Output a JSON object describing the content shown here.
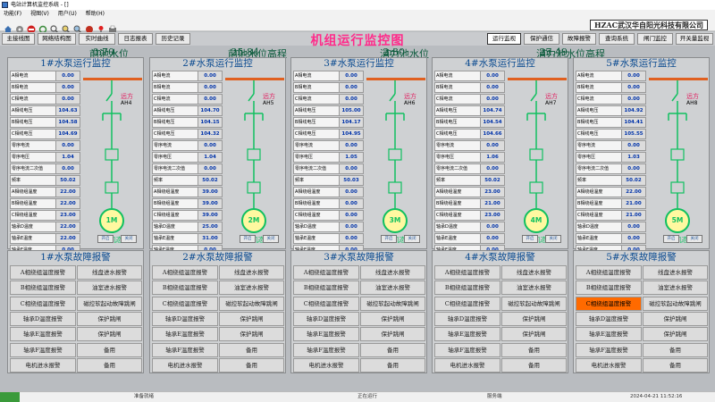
{
  "window": {
    "title": "电站计算机监控系统 - []"
  },
  "menu": [
    "功能(F)",
    "视图(V)",
    "用户(U)",
    "帮助(H)"
  ],
  "toolbar": {
    "icons": [
      "home-icon",
      "gear-icon",
      "stop-icon",
      "refresh-icon",
      "search-icon",
      "zoom-in-icon",
      "zoom-out-icon",
      "record-icon",
      "pin-icon",
      "print-icon"
    ]
  },
  "company": "HZAC武汉华自阳光科技有限公司",
  "nav_left": [
    "主接线图",
    "网络结构图",
    "实时曲线",
    "日志报表",
    "历史记录"
  ],
  "nav_right": [
    "运行监视",
    "保护通信",
    "故障报警",
    "查询系统",
    "闸门监控",
    "开关量监视"
  ],
  "page_title": "机组运行监控图",
  "levels": [
    {
      "label": "前池水位",
      "value": "0.70",
      "unit": "m"
    },
    {
      "label": "前池水位高程",
      "value": "25.84",
      "unit": "m"
    },
    {
      "label": "消力池水位",
      "value": "2.30",
      "unit": "m"
    },
    {
      "label": "消力池水位高程",
      "value": "27.49",
      "unit": "m"
    }
  ],
  "row_labels": [
    "A相电流",
    "B相电流",
    "C相电流",
    "A相线电压",
    "B相线电压",
    "C相线电压",
    "零序电流",
    "零序电压",
    "零序电流二次值",
    "频率",
    "A相绕组温度",
    "B相绕组温度",
    "C相绕组温度",
    "轴承D温度",
    "轴承E温度",
    "轴承F温度"
  ],
  "pumps": [
    {
      "title": "1#水泵运行监控",
      "values": [
        "0.00",
        "0.00",
        "0.00",
        "104.63",
        "104.58",
        "104.69",
        "0.00",
        "1.04",
        "0.00",
        "50.02",
        "22.00",
        "22.00",
        "23.00",
        "22.00",
        "22.00",
        "0.00"
      ],
      "ah": "AH4",
      "state": "停机态",
      "motor": "1M",
      "remote": "远方",
      "start": "开启",
      "stop": "关闭"
    },
    {
      "title": "2#水泵运行监控",
      "values": [
        "0.00",
        "0.00",
        "0.00",
        "104.70",
        "104.15",
        "104.32",
        "0.00",
        "1.04",
        "0.00",
        "50.02",
        "39.00",
        "39.00",
        "39.00",
        "25.00",
        "31.00",
        "0.00"
      ],
      "ah": "AH5",
      "state": "停机态",
      "motor": "2M",
      "remote": "远方",
      "start": "开启",
      "stop": "关闭"
    },
    {
      "title": "3#水泵运行监控",
      "values": [
        "0.00",
        "0.00",
        "0.00",
        "105.00",
        "104.17",
        "104.95",
        "0.00",
        "1.05",
        "0.00",
        "50.03",
        "0.00",
        "0.00",
        "0.00",
        "0.00",
        "0.00",
        "0.00"
      ],
      "ah": "AH6",
      "state": "停机态",
      "motor": "3M",
      "remote": "远方",
      "start": "开启",
      "stop": "关闭"
    },
    {
      "title": "4#水泵运行监控",
      "values": [
        "0.00",
        "0.00",
        "0.00",
        "104.74",
        "104.54",
        "104.66",
        "0.00",
        "1.06",
        "0.00",
        "50.02",
        "23.00",
        "21.00",
        "23.00",
        "0.00",
        "0.00",
        "0.00"
      ],
      "ah": "AH7",
      "state": "停机态",
      "motor": "4M",
      "remote": "远方",
      "start": "开启",
      "stop": "关闭"
    },
    {
      "title": "5#水泵运行监控",
      "values": [
        "0.00",
        "0.00",
        "0.00",
        "104.92",
        "104.41",
        "105.55",
        "0.00",
        "1.03",
        "0.00",
        "50.02",
        "22.00",
        "21.00",
        "21.00",
        "0.00",
        "0.00",
        "0.00"
      ],
      "ah": "AH8",
      "state": "停机态",
      "motor": "5M",
      "remote": "远方",
      "start": "开启",
      "stop": "关闭"
    }
  ],
  "fault_titles": [
    "1#水泵故障报警",
    "2#水泵故障报警",
    "3#水泵故障报警",
    "4#水泵故障报警",
    "5#水泵故障报警"
  ],
  "fault_cells": [
    "A相绕组温度报警",
    "线盘进水报警",
    "B相绕组温度报警",
    "油室进水报警",
    "C相绕组温度报警",
    "磁控软起动故障跳闸",
    "轴承D温度报警",
    "保护跳闸",
    "轴承E温度报警",
    "保护跳闸",
    "轴承F温度报警",
    "备用",
    "电机进水报警",
    "备用"
  ],
  "fault_alarm": {
    "panel": 4,
    "cell": 4
  },
  "status": {
    "s1": "准备就绪",
    "s2": "正在运行",
    "s3": "服务端",
    "time": "2024-04-21 11:52:16"
  },
  "colors": {
    "title": "#0a4a90",
    "value": "#0033aa",
    "alarm": "#ff6a00",
    "bus": "#e06020",
    "green": "#10c060",
    "level": "#0a5a3a",
    "page_title": "#ff2a8a"
  }
}
